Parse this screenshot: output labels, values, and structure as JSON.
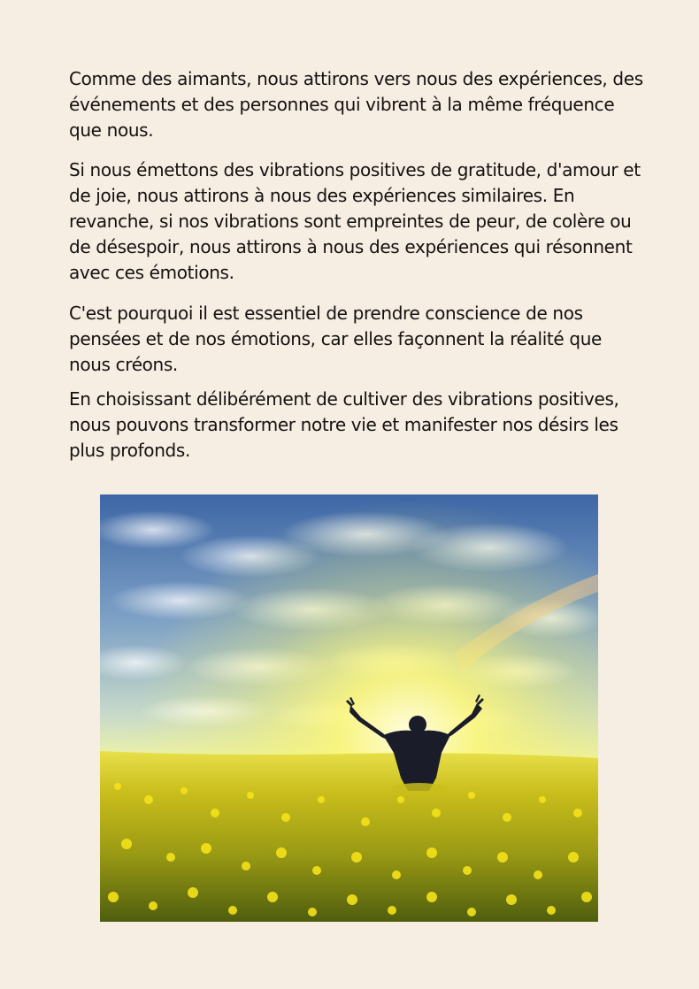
{
  "document": {
    "paragraphs": [
      "Comme des aimants, nous attirons vers nous des expériences, des événements et des personnes qui vibrent à la même fréquence que nous.",
      "Si nous émettons des vibrations positives de gratitude, d'amour et de joie, nous attirons à nous des expériences similaires. En revanche, si nos vibrations sont empreintes de peur, de colère ou de désespoir, nous attirons à nous des expériences qui résonnent avec ces émotions.",
      "C'est pourquoi il est essentiel de prendre conscience de nos pensées et de nos émotions, car elles façonnent la réalité que nous créons.",
      "En choisissant délibérément de cultiver des vibrations positives, nous pouvons transformer notre vie et manifester nos désirs les plus profonds."
    ]
  },
  "illustration": {
    "icon": "man-arms-raised-in-flower-field-photo",
    "colors": {
      "sky_top": "#3f6aa8",
      "sky_mid": "#9fc0d6",
      "sun_glow": "#f7f36a",
      "field": "#d6c81c",
      "field_dark": "#5b6a10",
      "background": "#f6ede3"
    }
  }
}
